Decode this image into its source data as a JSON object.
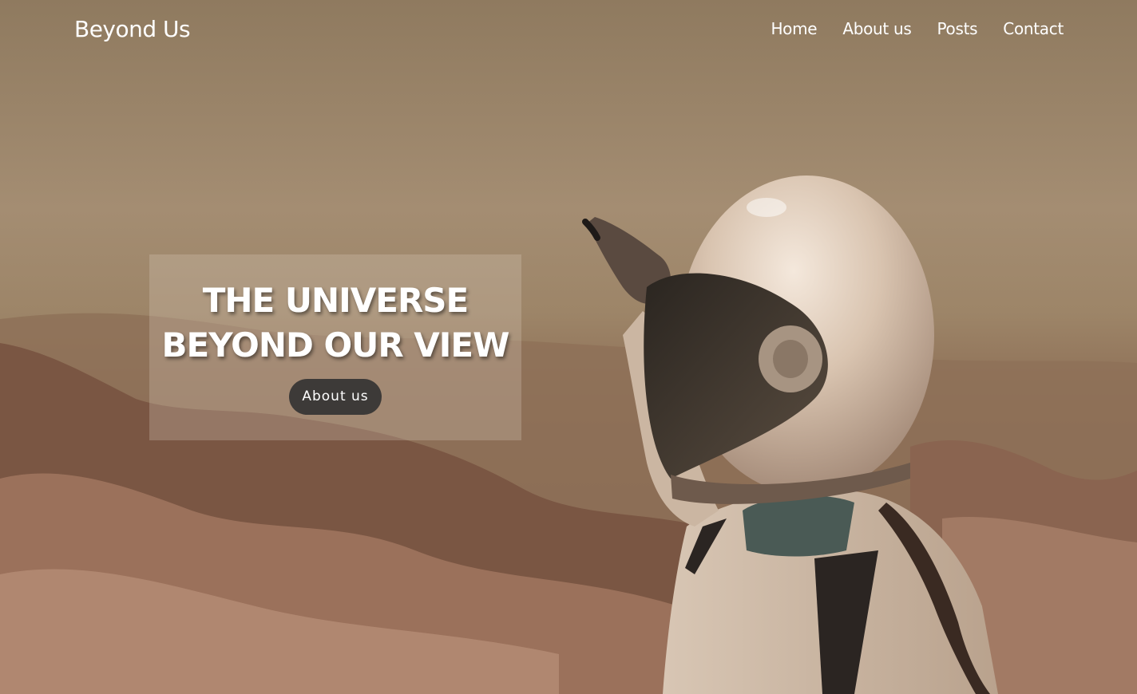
{
  "brand": {
    "name": "Beyond Us"
  },
  "nav": {
    "links": [
      {
        "label": "Home"
      },
      {
        "label": "About us"
      },
      {
        "label": "Posts"
      },
      {
        "label": "Contact"
      }
    ]
  },
  "hero": {
    "headline_line1": "THE UNIVERSE",
    "headline_line2": "BEYOND OUR VIEW",
    "cta_label": "About us",
    "background_image": "astronaut-in-desert-photo"
  },
  "colors": {
    "overlay_tint": "#8f7a5f",
    "button_bg": "#3d3a38",
    "text": "#ffffff"
  }
}
